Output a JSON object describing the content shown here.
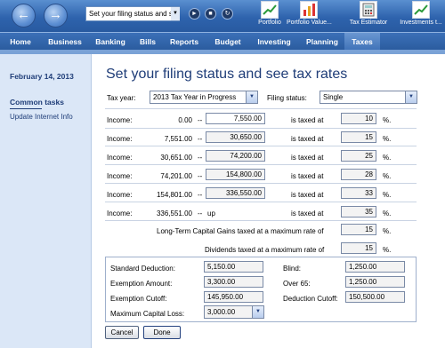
{
  "toolbar": {
    "address": "Set your filing status and s",
    "tools": [
      {
        "label": "Portfolio",
        "icon": "chart-up-icon"
      },
      {
        "label": "Portfolio Value...",
        "icon": "bar-chart-icon"
      },
      {
        "label": "Tax Estimator",
        "icon": "calculator-icon"
      },
      {
        "label": "Investments t...",
        "icon": "chart-up-icon"
      }
    ]
  },
  "tabs": [
    "Home",
    "Business",
    "Banking",
    "Bills",
    "Reports",
    "Budget",
    "Investing",
    "Planning",
    "Taxes"
  ],
  "active_tab": "Taxes",
  "sidebar": {
    "date": "February 14, 2013",
    "common_tasks": "Common tasks",
    "link": "Update Internet Info"
  },
  "main": {
    "title": "Set your filing status and see tax rates",
    "tax_year_label": "Tax year:",
    "tax_year_value": "2013 Tax Year in Progress",
    "filing_status_label": "Filing status:",
    "filing_status_value": "Single",
    "income_label": "Income:",
    "sep": "--",
    "taxed_label": "is taxed at",
    "pct": "%.",
    "brackets": [
      {
        "from": "0.00",
        "to": "7,550.00",
        "rate": "10"
      },
      {
        "from": "7,551.00",
        "to": "30,650.00",
        "rate": "15"
      },
      {
        "from": "30,651.00",
        "to": "74,200.00",
        "rate": "25"
      },
      {
        "from": "74,201.00",
        "to": "154,800.00",
        "rate": "28"
      },
      {
        "from": "154,801.00",
        "to": "336,550.00",
        "rate": "33"
      },
      {
        "from": "336,551.00",
        "to": "up",
        "rate": "35"
      }
    ],
    "ltcg_label": "Long-Term Capital Gains taxed at a maximum rate of",
    "ltcg_rate": "15",
    "div_label": "Dividends taxed at a maximum rate of",
    "div_rate": "15",
    "std_deduction_label": "Standard Deduction:",
    "std_deduction": "5,150.00",
    "exemption_label": "Exemption Amount:",
    "exemption": "3,300.00",
    "exemption_cutoff_label": "Exemption Cutoff:",
    "exemption_cutoff": "145,950.00",
    "max_cap_loss_label": "Maximum Capital Loss:",
    "max_cap_loss": "3,000.00",
    "blind_label": "Blind:",
    "blind": "1,250.00",
    "over65_label": "Over 65:",
    "over65": "1,250.00",
    "deduction_cutoff_label": "Deduction Cutoff:",
    "deduction_cutoff": "150,500.00",
    "cancel": "Cancel",
    "done": "Done"
  }
}
